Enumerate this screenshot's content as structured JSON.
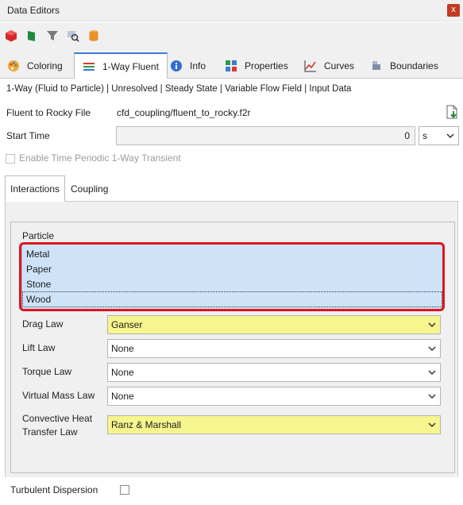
{
  "window": {
    "title": "Data Editors",
    "close_label": "x"
  },
  "toolbar": {
    "icons": [
      "red-cube-icon",
      "green-flag-icon",
      "filter-icon",
      "search-zoom-icon",
      "database-icon"
    ]
  },
  "tabs": [
    {
      "label": "Coloring",
      "icon": "palette-icon"
    },
    {
      "label": "1-Way Fluent",
      "icon": "fluent-icon",
      "active": true
    },
    {
      "label": "Info",
      "icon": "info-icon"
    },
    {
      "label": "Properties",
      "icon": "properties-icon"
    },
    {
      "label": "Curves",
      "icon": "curves-icon"
    },
    {
      "label": "Boundaries",
      "icon": "boundaries-icon"
    }
  ],
  "description": "1-Way (Fluid to Particle) | Unresolved | Steady State | Variable Flow Field | Input Data",
  "file": {
    "label": "Fluent to Rocky File",
    "value": "cfd_coupling/fluent_to_rocky.f2r"
  },
  "start_time": {
    "label": "Start Time",
    "value": "0",
    "unit": "s"
  },
  "periodic": {
    "label": "Enable Time Periodic 1-Way Transient",
    "checked": false
  },
  "subtabs": [
    {
      "label": "Interactions",
      "active": true
    },
    {
      "label": "Coupling"
    }
  ],
  "particle": {
    "label": "Particle",
    "items": [
      "Metal",
      "Paper",
      "Stone",
      "Wood"
    ]
  },
  "laws": [
    {
      "label": "Drag Law",
      "value": "Ganser",
      "highlight": true
    },
    {
      "label": "Lift Law",
      "value": "None"
    },
    {
      "label": "Torque Law",
      "value": "None"
    },
    {
      "label": "Virtual Mass Law",
      "value": "None"
    },
    {
      "label_line1": "Convective Heat",
      "label_line2": "Transfer Law",
      "value": "Ranz & Marshall",
      "highlight": true
    }
  ],
  "turbulent": {
    "label": "Turbulent Dispersion",
    "checked": false
  },
  "colors": {
    "accent": "#3a7bd5",
    "highlight_yellow": "#f6f58e",
    "selection_blue": "#cfe3f8",
    "callout_red": "#e0141e"
  }
}
